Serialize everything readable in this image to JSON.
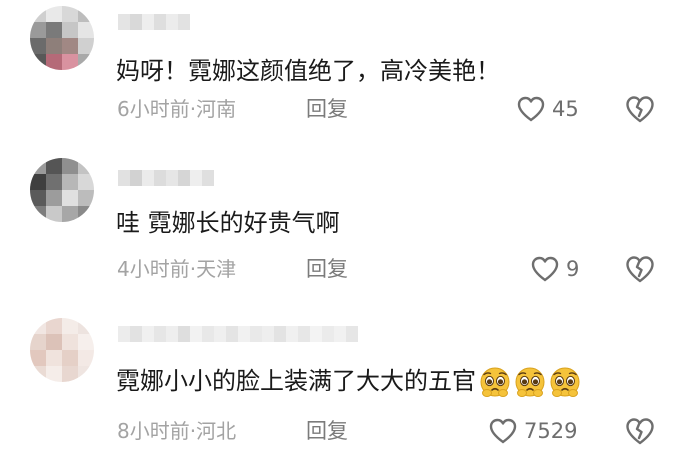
{
  "comments": [
    {
      "text": "妈呀！霓娜这颜值绝了，高冷美艳！",
      "time": "6小时前",
      "location": "河南",
      "reply_label": "回复",
      "likes": "45",
      "like_icon": "heart-outline-icon",
      "dislike_icon": "broken-heart-icon"
    },
    {
      "text": "哇 霓娜长的好贵气啊",
      "time": "4小时前",
      "location": "天津",
      "reply_label": "回复",
      "likes": "9",
      "like_icon": "heart-outline-icon",
      "dislike_icon": "broken-heart-icon"
    },
    {
      "text": "霓娜小小的脸上装满了大大的五官",
      "emoji": "pleading-face-emoji",
      "emoji_count": 3,
      "time": "8小时前",
      "location": "河北",
      "reply_label": "回复",
      "likes": "7529",
      "like_icon": "heart-outline-icon",
      "dislike_icon": "broken-heart-icon"
    }
  ],
  "meta_separator": "·",
  "colors": {
    "text": "#1a1a1a",
    "meta": "#a3a3a3",
    "icon": "#6e6e6e",
    "emoji": "#f5c33b"
  }
}
